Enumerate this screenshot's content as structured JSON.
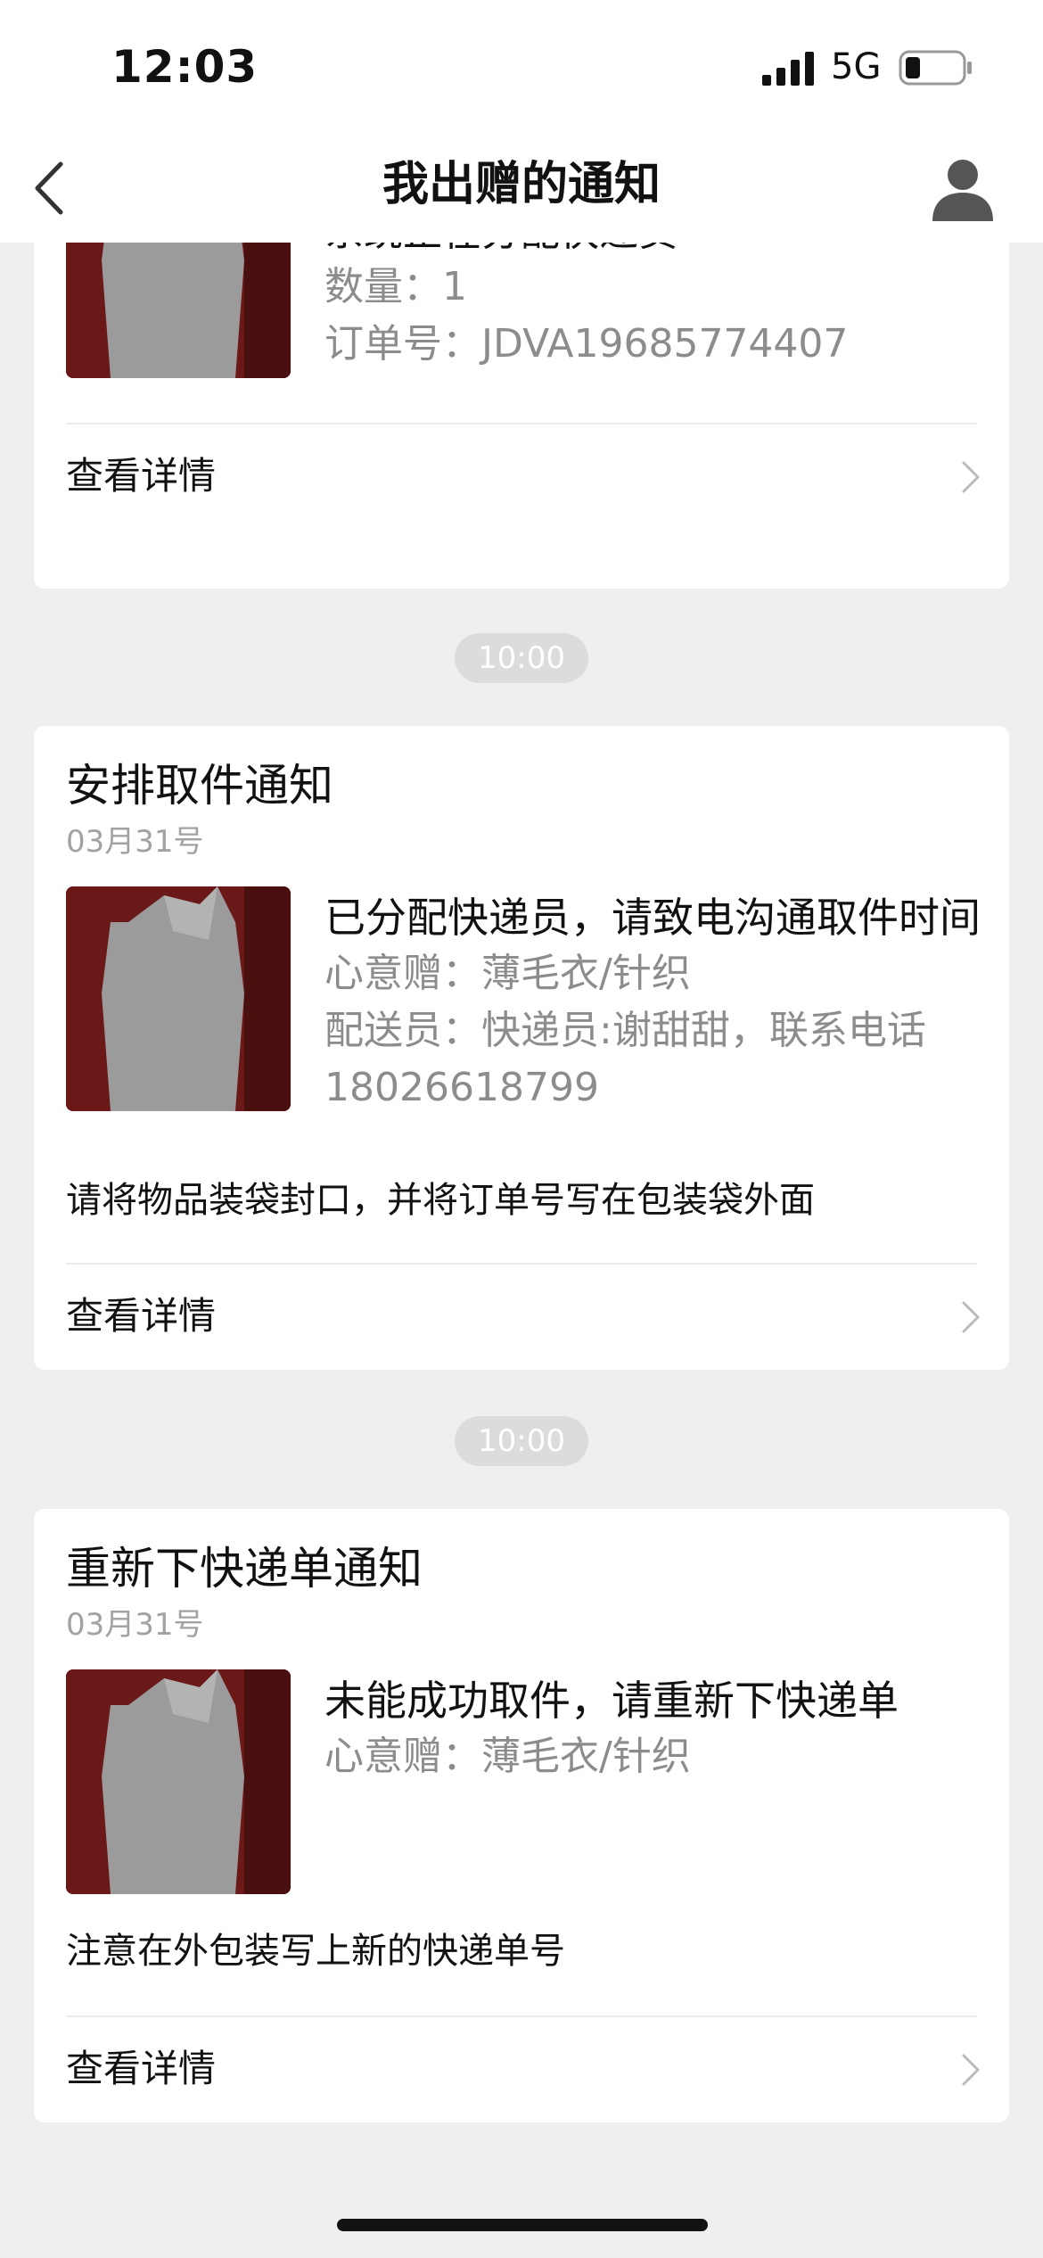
{
  "status_bar": {
    "time": "12:03",
    "network": "5G",
    "icons": [
      "signal-icon",
      "battery-icon"
    ]
  },
  "nav": {
    "title": "我出赠的通知",
    "back_icon": "chevron-left-icon",
    "profile_icon": "user-icon"
  },
  "cards": [
    {
      "partial_top_text": "系统正在分配快递员",
      "lines": [
        "数量：1",
        "订单号：JDVA19685774407"
      ],
      "detail_label": "查看详情"
    },
    {
      "title": "安排取件通知",
      "date": "03月31号",
      "main": "已分配快递员，请致电沟通取件时间",
      "lines": [
        "心意赠：薄毛衣/针织",
        "配送员：快递员:谢甜甜，联系电话18026618799"
      ],
      "note": "请将物品装袋封口，并将订单号写在包装袋外面",
      "detail_label": "查看详情"
    },
    {
      "title": "重新下快递单通知",
      "date": "03月31号",
      "main": "未能成功取件，请重新下快递单",
      "lines": [
        "心意赠：薄毛衣/针织"
      ],
      "note": "注意在外包装写上新的快递单号",
      "detail_label": "查看详情"
    }
  ],
  "timestamps": [
    "10:00",
    "10:00"
  ],
  "colors": {
    "background": "#efefef",
    "card": "#ffffff",
    "secondary_text": "#8c8c8c",
    "date_text": "#a2a2a2",
    "pill": "#dcdcdc"
  }
}
